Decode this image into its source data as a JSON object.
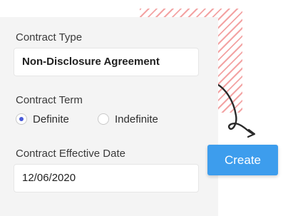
{
  "form": {
    "contract_type": {
      "label": "Contract Type",
      "value": "Non-Disclosure Agreement"
    },
    "contract_term": {
      "label": "Contract Term",
      "options": [
        {
          "label": "Definite",
          "selected": true
        },
        {
          "label": "Indefinite",
          "selected": false
        }
      ]
    },
    "effective_date": {
      "label": "Contract Effective Date",
      "value": "12/06/2020"
    }
  },
  "actions": {
    "create_label": "Create"
  },
  "colors": {
    "accent_button": "#3d9ded",
    "radio_selected": "#4a5bd8",
    "stripe": "#f3a3a3",
    "card_background": "#f4f4f4"
  }
}
